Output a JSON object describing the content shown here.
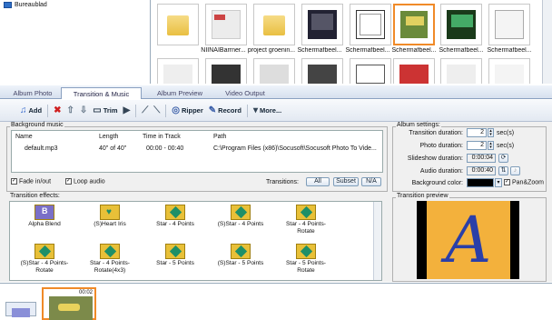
{
  "tree": {
    "folder_label": "Bureaublad"
  },
  "thumbs": {
    "row1_captions": [
      "",
      "NIINAIBarrner...",
      "project groenin...",
      "Schermafbeel...",
      "Schermafbeel...",
      "Schermafbeel...",
      "Schermafbeel...",
      "Schermafbeel..."
    ]
  },
  "tabs": [
    "Album Photo",
    "Transition & Music",
    "Album Preview",
    "Video Output"
  ],
  "toolbar": {
    "add": "Add",
    "trim": "Trim",
    "ripper": "Ripper",
    "record": "Record",
    "more": "More..."
  },
  "bg_music": {
    "title": "Background music",
    "headers": [
      "Name",
      "Length",
      "Time in Track",
      "Path"
    ],
    "row": {
      "name": "default.mp3",
      "length": "40\" of 40\"",
      "time": "00:00 - 00:40",
      "path": "C:\\Program Files (x86)\\Socusoft\\Socusoft Photo To Vide..."
    },
    "fade": "Fade in/out",
    "loop": "Loop audio",
    "transitions_label": "Transitions:",
    "btn_all": "All",
    "btn_subset": "Subset",
    "btn_na": "N/A"
  },
  "effects": {
    "title": "Transition effects:",
    "items": [
      "Alpha Blend",
      "(S)Heart Iris",
      "Star - 4 Points",
      "(S)Star - 4 Points",
      "Star - 4 Points-Rotate",
      "(S)Star - 4 Points-Rotate",
      "Star - 4 Points-Rotate(4x3)",
      "Star - 5 Points",
      "(S)Star - 5 Points",
      "Star - 5 Points-Rotate"
    ]
  },
  "album": {
    "title": "Album settings:",
    "transition_duration_label": "Transition duration:",
    "transition_duration": "2",
    "photo_duration_label": "Photo duration:",
    "photo_duration": "2",
    "slideshow_duration_label": "Slideshow duration:",
    "slideshow_duration": "0:00:04",
    "audio_duration_label": "Audio duration:",
    "audio_duration": "0:00:40",
    "bg_color_label": "Background color:",
    "panzoom": "Pan&Zoom",
    "unit": "sec(s)"
  },
  "preview": {
    "title": "Transition preview",
    "letter": "A"
  },
  "story": {
    "frame_num": "00:02"
  }
}
